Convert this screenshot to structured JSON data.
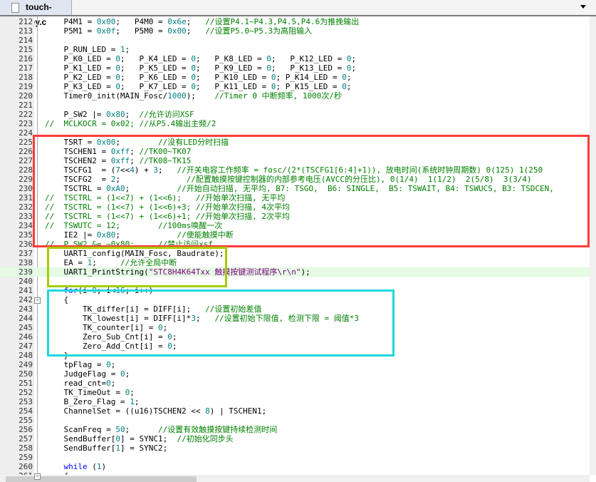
{
  "tab": {
    "title": "touch-key.c",
    "icon": "file-icon"
  },
  "current_line": 239,
  "colors": {
    "number": "#008080",
    "comment": "#008000",
    "keyword": "#0000ff",
    "string": "#800080",
    "box_red": "#ff3b3b",
    "box_green": "#a6cc00",
    "box_cyan": "#1ed8dc"
  },
  "lines": [
    {
      "n": 212,
      "t": [
        [
          "p",
          "    P4M1 = "
        ],
        [
          "n",
          "0x00"
        ],
        [
          "p",
          ";   P4M0 = "
        ],
        [
          "n",
          "0x6e"
        ],
        [
          "p",
          ";   "
        ],
        [
          "c",
          "//设置P4.1~P4.3,P4.5,P4.6为推挽输出"
        ]
      ]
    },
    {
      "n": 213,
      "t": [
        [
          "p",
          "    P5M1 = "
        ],
        [
          "n",
          "0x0f"
        ],
        [
          "p",
          ";   P5M0 = "
        ],
        [
          "n",
          "0x00"
        ],
        [
          "p",
          ";   "
        ],
        [
          "c",
          "//设置P5.0~P5.3为高阻输入"
        ]
      ]
    },
    {
      "n": 214,
      "t": []
    },
    {
      "n": 215,
      "t": [
        [
          "p",
          "    P_RUN_LED = "
        ],
        [
          "n",
          "1"
        ],
        [
          "p",
          ";"
        ]
      ]
    },
    {
      "n": 216,
      "t": [
        [
          "p",
          "    P_K0_LED = "
        ],
        [
          "n",
          "0"
        ],
        [
          "p",
          ";   P_K4_LED = "
        ],
        [
          "n",
          "0"
        ],
        [
          "p",
          ";   P_K8_LED = "
        ],
        [
          "n",
          "0"
        ],
        [
          "p",
          ";   P_K12_LED = "
        ],
        [
          "n",
          "0"
        ],
        [
          "p",
          ";"
        ]
      ]
    },
    {
      "n": 217,
      "t": [
        [
          "p",
          "    P_K1_LED = "
        ],
        [
          "n",
          "0"
        ],
        [
          "p",
          ";   P_K5_LED = "
        ],
        [
          "n",
          "0"
        ],
        [
          "p",
          ";   P_K9_LED = "
        ],
        [
          "n",
          "0"
        ],
        [
          "p",
          ";   P_K13_LED = "
        ],
        [
          "n",
          "0"
        ],
        [
          "p",
          ";"
        ]
      ]
    },
    {
      "n": 218,
      "t": [
        [
          "p",
          "    P_K2_LED = "
        ],
        [
          "n",
          "0"
        ],
        [
          "p",
          ";   P_K6_LED = "
        ],
        [
          "n",
          "0"
        ],
        [
          "p",
          ";   P_K10_LED = "
        ],
        [
          "n",
          "0"
        ],
        [
          "p",
          "; P_K14_LED = "
        ],
        [
          "n",
          "0"
        ],
        [
          "p",
          ";"
        ]
      ]
    },
    {
      "n": 219,
      "t": [
        [
          "p",
          "    P_K3_LED = "
        ],
        [
          "n",
          "0"
        ],
        [
          "p",
          ";   P_K7_LED = "
        ],
        [
          "n",
          "0"
        ],
        [
          "p",
          ";   P_K11_LED = "
        ],
        [
          "n",
          "0"
        ],
        [
          "p",
          "; P_K15_LED = "
        ],
        [
          "n",
          "0"
        ],
        [
          "p",
          ";"
        ]
      ]
    },
    {
      "n": 220,
      "t": [
        [
          "p",
          "    Timer0_init(MAIN_Fosc/"
        ],
        [
          "n",
          "1000"
        ],
        [
          "p",
          ");    "
        ],
        [
          "c",
          "//Timer 0 中断频率, 1000次/秒"
        ]
      ]
    },
    {
      "n": 221,
      "t": []
    },
    {
      "n": 222,
      "t": [
        [
          "p",
          "    P_SW2 |= "
        ],
        [
          "n",
          "0x80"
        ],
        [
          "p",
          ";  "
        ],
        [
          "c",
          "//允许访问XSF"
        ]
      ]
    },
    {
      "n": 223,
      "t": [
        [
          "c",
          "//  MCLKOCR = 0x02; //从P5.4输出主频/2"
        ]
      ]
    },
    {
      "n": 224,
      "t": []
    },
    {
      "n": 225,
      "t": [
        [
          "p",
          "    TSRT = "
        ],
        [
          "n",
          "0x00"
        ],
        [
          "p",
          ";        "
        ],
        [
          "c",
          "//没有LED分时扫描"
        ]
      ]
    },
    {
      "n": 226,
      "t": [
        [
          "p",
          "    TSCHEN1 = "
        ],
        [
          "n",
          "0xff"
        ],
        [
          "p",
          "; "
        ],
        [
          "c",
          "//TK00~TK07"
        ]
      ]
    },
    {
      "n": 227,
      "t": [
        [
          "p",
          "    TSCHEN2 = "
        ],
        [
          "n",
          "0xff"
        ],
        [
          "p",
          "; "
        ],
        [
          "c",
          "//TK08~TK15"
        ]
      ]
    },
    {
      "n": 228,
      "t": [
        [
          "p",
          "    TSCFG1  = ("
        ],
        [
          "n",
          "7"
        ],
        [
          "p",
          "<<"
        ],
        [
          "n",
          "4"
        ],
        [
          "p",
          ") + "
        ],
        [
          "n",
          "3"
        ],
        [
          "p",
          ";   "
        ],
        [
          "c",
          "//开关电容工作频率 = fosc/(2*(TSCFG1[6:4]+1)), 放电时间(系统时钟周期数) 0(125) 1(250"
        ]
      ]
    },
    {
      "n": 229,
      "t": [
        [
          "p",
          "    TSCFG2  = "
        ],
        [
          "n",
          "2"
        ],
        [
          "p",
          ";              "
        ],
        [
          "c",
          "//配置触摸按键控制器的内部参考电压(AVCC的分压比), 0(1/4)  1(1/2)  2(5/8)  3(3/4)"
        ]
      ]
    },
    {
      "n": 230,
      "t": [
        [
          "p",
          "    TSCTRL = "
        ],
        [
          "n",
          "0xA0"
        ],
        [
          "p",
          ";          "
        ],
        [
          "c",
          "//开始自动扫描, 无平均, B7: TSGO,  B6: SINGLE,  B5: TSWAIT, B4: TSWUCS, B3: TSDCEN,"
        ]
      ]
    },
    {
      "n": 231,
      "t": [
        [
          "c",
          "//  TSCTRL = (1<<7) + (1<<6);   //开始单次扫描, 无平均"
        ]
      ]
    },
    {
      "n": 232,
      "t": [
        [
          "c",
          "//  TSCTRL = (1<<7) + (1<<6)+3; //开始单次扫描, 4次平均"
        ]
      ]
    },
    {
      "n": 233,
      "t": [
        [
          "c",
          "//  TSCTRL = (1<<7) + (1<<6)+1; //开始单次扫描, 2次平均"
        ]
      ]
    },
    {
      "n": 234,
      "t": [
        [
          "c",
          "//  TSWUTC = 12;        //100ms唤醒一次"
        ]
      ]
    },
    {
      "n": 235,
      "t": [
        [
          "p",
          "    IE2 |= "
        ],
        [
          "n",
          "0x80"
        ],
        [
          "p",
          ";            "
        ],
        [
          "c",
          "//使能触摸中断"
        ]
      ]
    },
    {
      "n": 236,
      "t": [
        [
          "c",
          "//  P_SW2 &= ~0x80;     //禁止访问xsf"
        ]
      ]
    },
    {
      "n": 237,
      "t": [
        [
          "p",
          "    UART1_config(MAIN_Fosc, Baudrate);"
        ]
      ]
    },
    {
      "n": 238,
      "t": [
        [
          "p",
          "    EA = "
        ],
        [
          "n",
          "1"
        ],
        [
          "p",
          ";     "
        ],
        [
          "c",
          "//允许全局中断"
        ]
      ]
    },
    {
      "n": 239,
      "t": [
        [
          "p",
          "    UART1_PrintString("
        ],
        [
          "s",
          "\"STC8H4K64Txx 触摸按键测试程序\\r\\n\""
        ],
        [
          "p",
          ");"
        ]
      ]
    },
    {
      "n": 240,
      "t": []
    },
    {
      "n": 241,
      "t": [
        [
          "p",
          "    "
        ],
        [
          "k",
          "for"
        ],
        [
          "p",
          "(i="
        ],
        [
          "n",
          "0"
        ],
        [
          "p",
          "; i<"
        ],
        [
          "n",
          "16"
        ],
        [
          "p",
          "; i++)"
        ]
      ]
    },
    {
      "n": 242,
      "t": [
        [
          "p",
          "    {"
        ]
      ]
    },
    {
      "n": 243,
      "t": [
        [
          "p",
          "        TK_differ[i] = DIFF[i];   "
        ],
        [
          "c",
          "//设置初始差值"
        ]
      ]
    },
    {
      "n": 244,
      "t": [
        [
          "p",
          "        TK_lowest[i] = DIFF[i]*"
        ],
        [
          "n",
          "3"
        ],
        [
          "p",
          ";   "
        ],
        [
          "c",
          "//设置初始下限值, 检测下限 = 阈值*3"
        ]
      ]
    },
    {
      "n": 245,
      "t": [
        [
          "p",
          "        TK_counter[i] = "
        ],
        [
          "n",
          "0"
        ],
        [
          "p",
          ";"
        ]
      ]
    },
    {
      "n": 246,
      "t": [
        [
          "p",
          "        Zero_Sub_Cnt[i] = "
        ],
        [
          "n",
          "0"
        ],
        [
          "p",
          ";"
        ]
      ]
    },
    {
      "n": 247,
      "t": [
        [
          "p",
          "        Zero_Add_Cnt[i] = "
        ],
        [
          "n",
          "0"
        ],
        [
          "p",
          ";"
        ]
      ]
    },
    {
      "n": 248,
      "t": [
        [
          "p",
          "    }"
        ]
      ]
    },
    {
      "n": 249,
      "t": [
        [
          "p",
          "    tpFlag = "
        ],
        [
          "n",
          "0"
        ],
        [
          "p",
          ";"
        ]
      ]
    },
    {
      "n": 250,
      "t": [
        [
          "p",
          "    JudgeFlag = "
        ],
        [
          "n",
          "0"
        ],
        [
          "p",
          ";"
        ]
      ]
    },
    {
      "n": 251,
      "t": [
        [
          "p",
          "    read_cnt="
        ],
        [
          "n",
          "0"
        ],
        [
          "p",
          ";"
        ]
      ]
    },
    {
      "n": 252,
      "t": [
        [
          "p",
          "    TK_TimeOut = "
        ],
        [
          "n",
          "0"
        ],
        [
          "p",
          ";"
        ]
      ]
    },
    {
      "n": 253,
      "t": [
        [
          "p",
          "    B_Zero_Flag = "
        ],
        [
          "n",
          "1"
        ],
        [
          "p",
          ";"
        ]
      ]
    },
    {
      "n": 254,
      "t": [
        [
          "p",
          "    ChannelSet = ((u16)TSCHEN2 << "
        ],
        [
          "n",
          "8"
        ],
        [
          "p",
          ") | TSCHEN1;"
        ]
      ]
    },
    {
      "n": 255,
      "t": []
    },
    {
      "n": 256,
      "t": [
        [
          "p",
          "    ScanFreq = "
        ],
        [
          "n",
          "50"
        ],
        [
          "p",
          ";      "
        ],
        [
          "c",
          "//设置有效触摸按键持续检测时间"
        ]
      ]
    },
    {
      "n": 257,
      "t": [
        [
          "p",
          "    SendBuffer["
        ],
        [
          "n",
          "0"
        ],
        [
          "p",
          "] = SYNC1;  "
        ],
        [
          "c",
          "//初始化同步头"
        ]
      ]
    },
    {
      "n": 258,
      "t": [
        [
          "p",
          "    SendBuffer["
        ],
        [
          "n",
          "1"
        ],
        [
          "p",
          "] = SYNC2;"
        ]
      ]
    },
    {
      "n": 259,
      "t": []
    },
    {
      "n": 260,
      "t": [
        [
          "p",
          "    "
        ],
        [
          "k",
          "while"
        ],
        [
          "p",
          " ("
        ],
        [
          "n",
          "1"
        ],
        [
          "p",
          ")"
        ]
      ]
    },
    {
      "n": 261,
      "t": [
        [
          "p",
          "    {"
        ]
      ]
    }
  ]
}
